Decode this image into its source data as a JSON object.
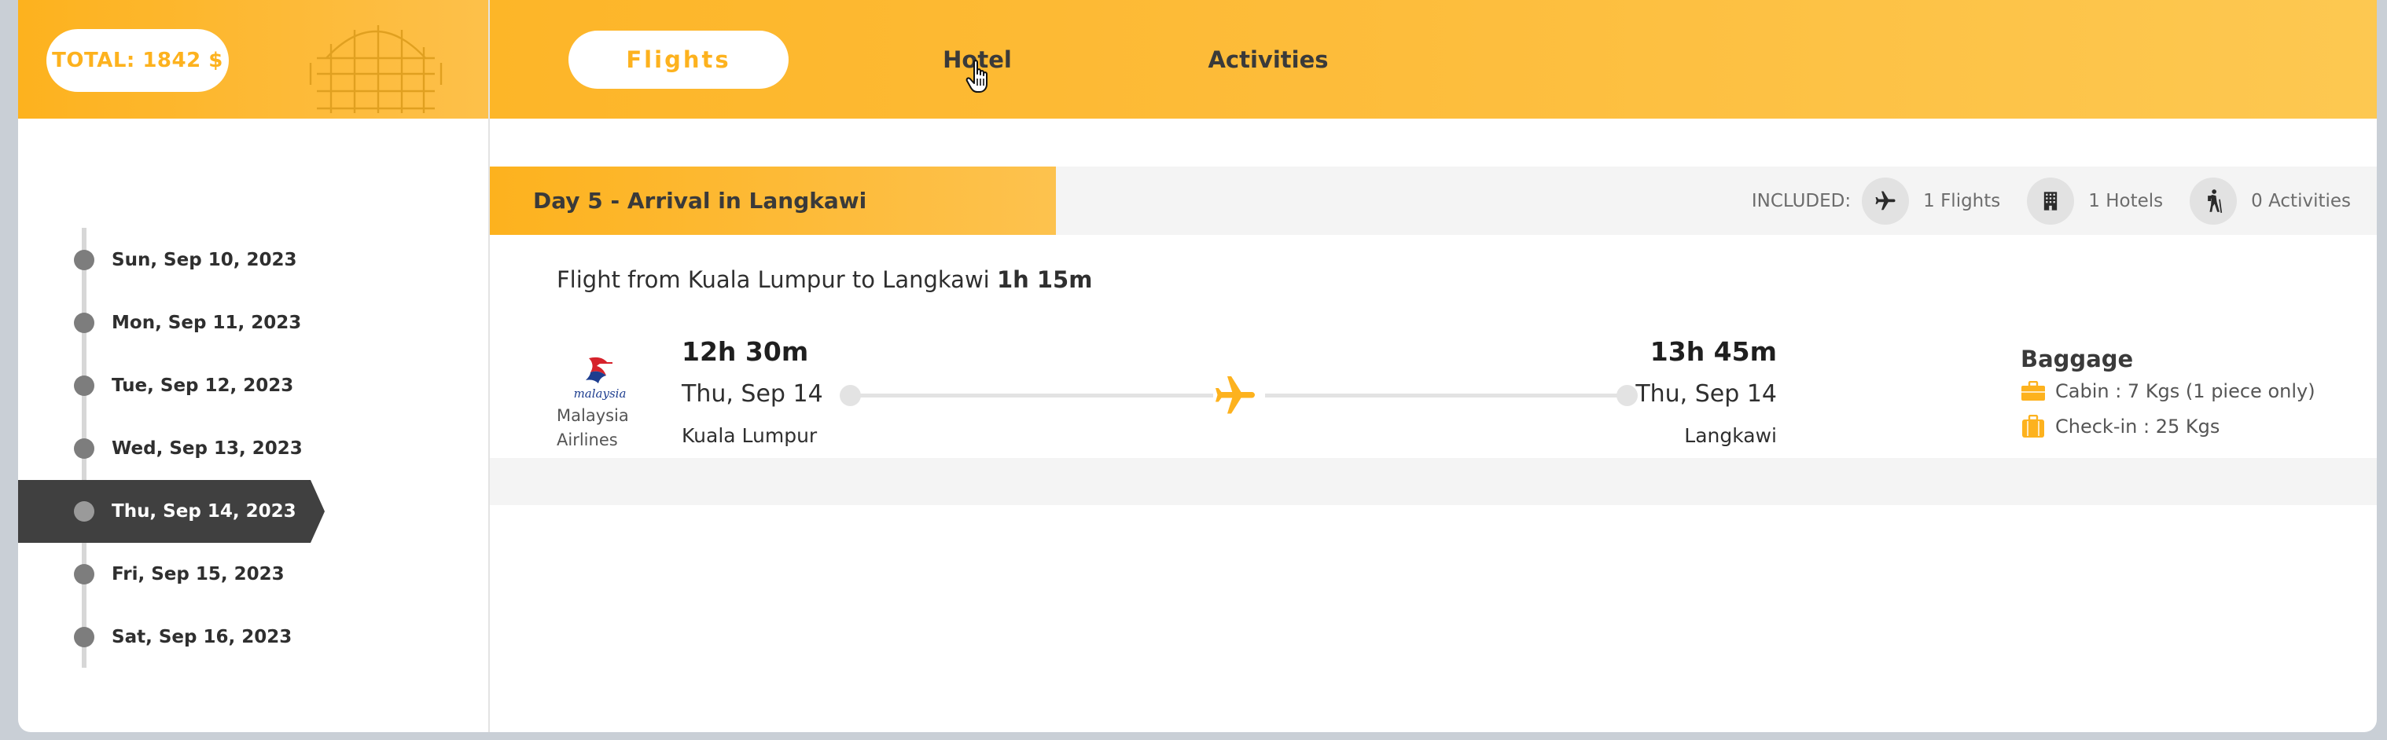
{
  "header": {
    "total_label": "TOTAL: 1842 $",
    "tabs": [
      {
        "label": "Flights",
        "active": true
      },
      {
        "label": "Hotel",
        "active": false
      },
      {
        "label": "Activities",
        "active": false
      }
    ]
  },
  "sidebar": {
    "days": [
      {
        "label": "Sun, Sep 10, 2023",
        "active": false
      },
      {
        "label": "Mon, Sep 11, 2023",
        "active": false
      },
      {
        "label": "Tue, Sep 12, 2023",
        "active": false
      },
      {
        "label": "Wed, Sep 13, 2023",
        "active": false
      },
      {
        "label": "Thu, Sep 14, 2023",
        "active": true
      },
      {
        "label": "Fri, Sep 15, 2023",
        "active": false
      },
      {
        "label": "Sat, Sep 16, 2023",
        "active": false
      }
    ]
  },
  "day": {
    "title": "Day 5 - Arrival in Langkawi",
    "included_label": "INCLUDED:",
    "flights_count": "1 Flights",
    "hotels_count": "1 Hotels",
    "activities_count": "0 Activities"
  },
  "flight": {
    "title": "Flight from Kuala Lumpur to Langkawi",
    "duration": "1h 15m",
    "airline": "Malaysia Airlines",
    "airline_logo_text": "malaysia",
    "departure": {
      "time": "12h 30m",
      "date": "Thu, Sep 14",
      "city": "Kuala Lumpur"
    },
    "arrival": {
      "time": "13h 45m",
      "date": "Thu, Sep 14",
      "city": "Langkawi"
    },
    "baggage": {
      "title": "Baggage",
      "cabin": "Cabin : 7 Kgs (1 piece only)",
      "checkin": "Check-in : 25 Kgs"
    }
  },
  "colors": {
    "accent": "#fdb21e",
    "dark": "#404040",
    "band": "#f4f4f4"
  }
}
